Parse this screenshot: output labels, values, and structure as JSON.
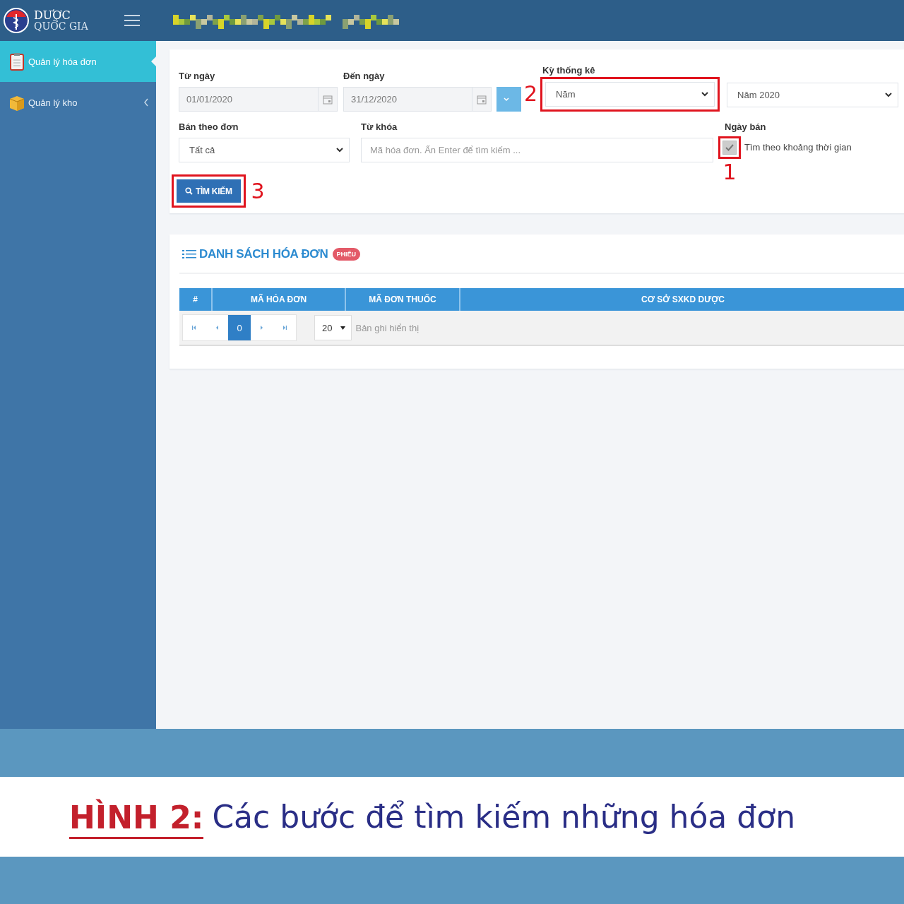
{
  "brand": {
    "line1": "DƯỢC",
    "line2": "QUỐC GIA"
  },
  "sidebar": {
    "items": [
      {
        "label": "Quản lý hóa đơn",
        "selected": true,
        "has_submenu": false
      },
      {
        "label": "Quản lý kho",
        "selected": false,
        "has_submenu": true
      }
    ]
  },
  "filters": {
    "from_date": {
      "label": "Từ ngày",
      "value": "01/01/2020",
      "disabled": true
    },
    "to_date": {
      "label": "Đến ngày",
      "value": "31/12/2020",
      "disabled": true
    },
    "period": {
      "label": "Kỳ thống kê",
      "value": "Năm",
      "callout": "2"
    },
    "year": {
      "value": "Năm 2020"
    },
    "invoice_type": {
      "label": "Bán theo đơn",
      "value": "Tất cả"
    },
    "keyword": {
      "label": "Từ khóa",
      "placeholder": "Mã hóa đơn. Ấn Enter để tìm kiếm ..."
    },
    "sale_date": {
      "label": "Ngày bán",
      "checked": true,
      "option": "Tìm theo khoảng thời gian",
      "callout": "1"
    },
    "search_button": {
      "label": "TÌM KIẾM",
      "callout": "3"
    }
  },
  "invoice_list": {
    "title": "DANH SÁCH HÓA ĐƠN",
    "badge": "PHIẾU",
    "columns": [
      "#",
      "MÃ HÓA ĐƠN",
      "MÃ ĐƠN THUỐC",
      "CƠ SỞ SXKD DƯỢC"
    ],
    "pager": {
      "pages": [
        {
          "label": "0",
          "selected": true
        }
      ],
      "page_size": "20",
      "page_size_label": "Bản ghi hiển thị"
    }
  },
  "caption": {
    "label": "HÌNH 2:",
    "text": "Các bước để tìm kiếm những hóa đơn"
  }
}
